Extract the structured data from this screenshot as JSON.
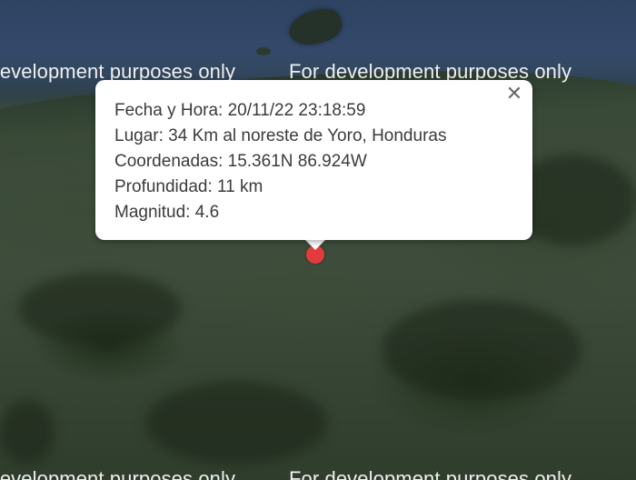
{
  "map": {
    "watermark_text": "For development purposes only",
    "watermark_text_cut": "ment purposes only",
    "watermark_text_bottom_left": "ment purposes only",
    "watermark_text_bottom_right": "For development purposes only"
  },
  "popup": {
    "close_glyph": "✕",
    "lines": [
      "Fecha y Hora: 20/11/22 23:18:59",
      "Lugar: 34 Km al noreste de Yoro, Honduras",
      "Coordenadas: 15.361N 86.924W",
      "Profundidad: 11 km",
      "Magnitud: 4.6"
    ]
  },
  "marker": {
    "color": "#e33b3b",
    "icon": "map-marker-icon"
  }
}
